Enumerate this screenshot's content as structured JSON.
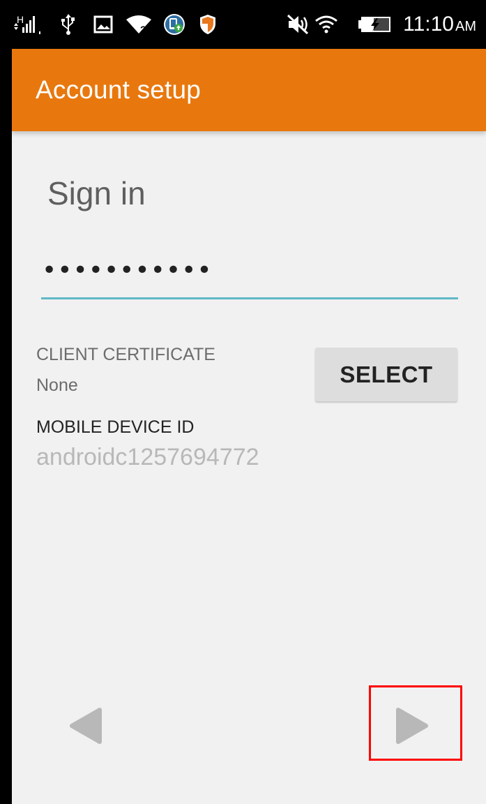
{
  "status_bar": {
    "network_type": "H",
    "time": "11:10",
    "ampm": "AM",
    "icons": [
      "signal-icon",
      "usb-icon",
      "image-icon",
      "wifi-unknown-icon",
      "app-update-icon",
      "shield-icon",
      "mute-icon",
      "wifi-icon",
      "battery-charging-icon"
    ]
  },
  "toolbar": {
    "title": "Account setup",
    "color": "#e8780e"
  },
  "form": {
    "heading": "Sign in",
    "password_masked": "•••••••••••",
    "underline_color": "#5fb9c6"
  },
  "client_certificate": {
    "label": "CLIENT CERTIFICATE",
    "value": "None",
    "button_label": "SELECT"
  },
  "mobile_device": {
    "label": "MOBILE DEVICE ID",
    "value": "androidc1257694772"
  },
  "navigation": {
    "prev_icon": "previous-arrow-icon",
    "next_icon": "next-arrow-icon",
    "highlight_color": "#ff0000"
  }
}
